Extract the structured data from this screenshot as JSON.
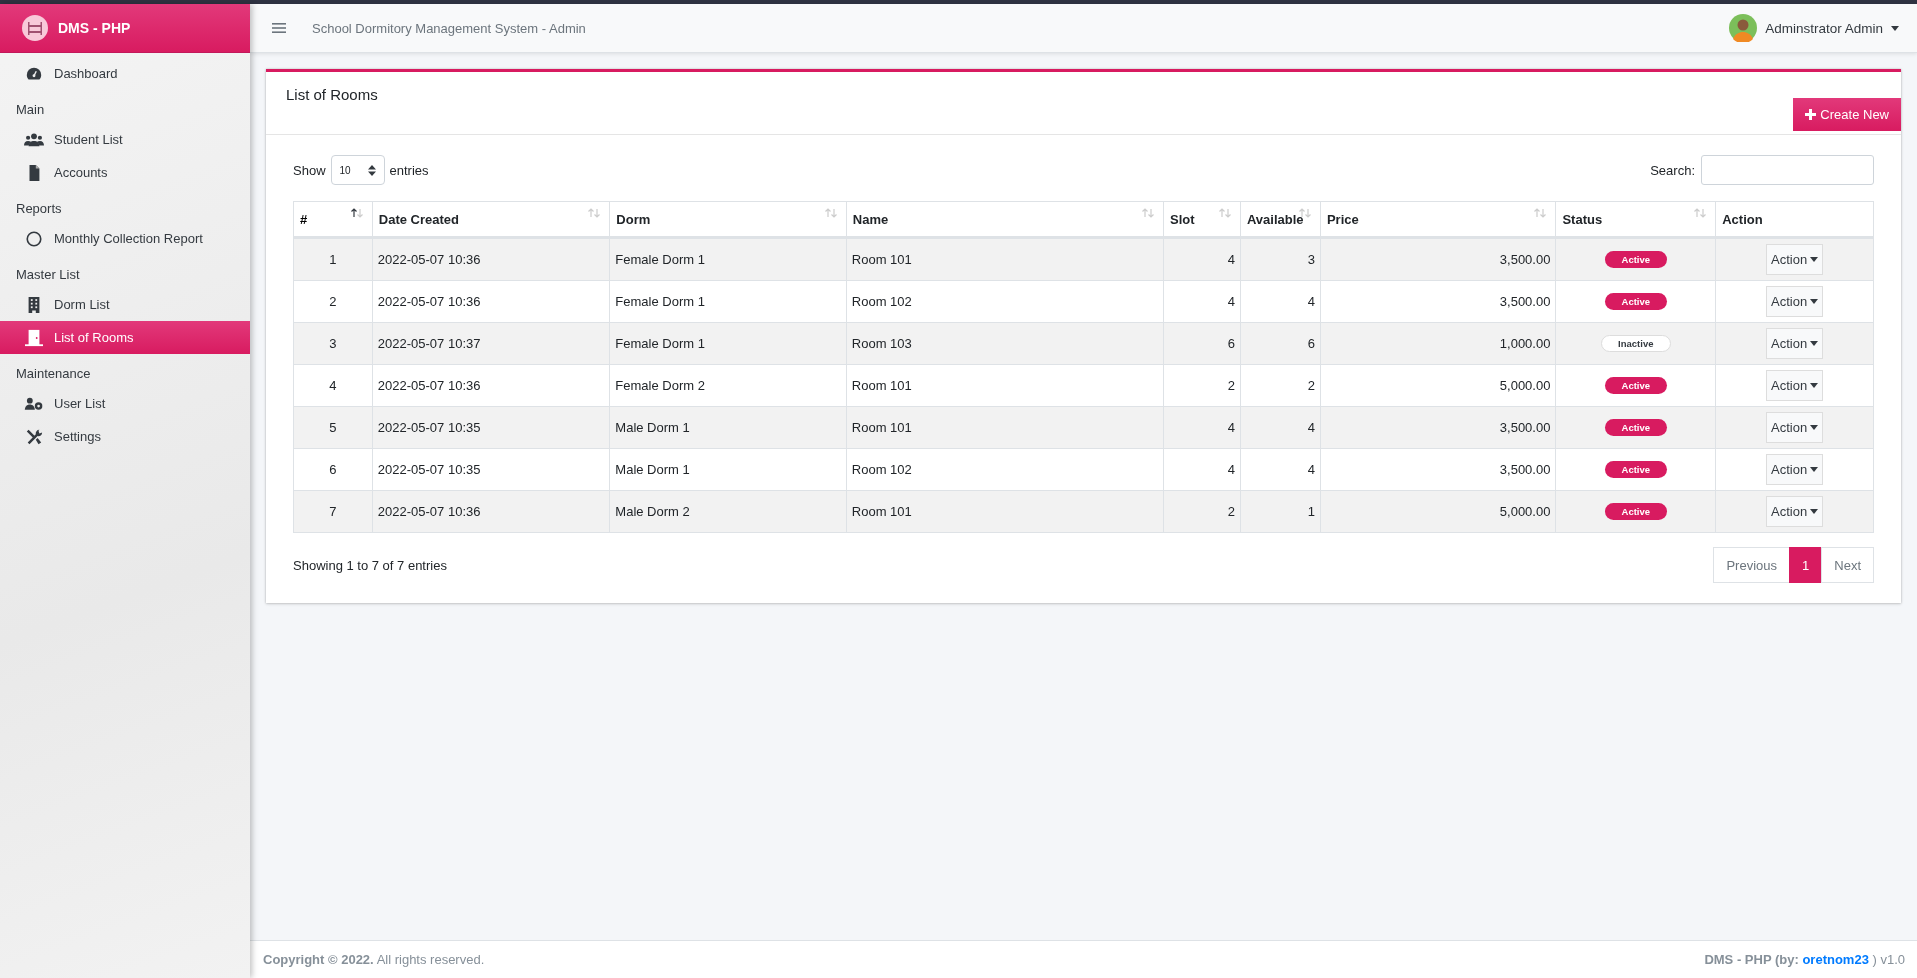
{
  "brand": {
    "title": "DMS - PHP"
  },
  "sidebar": {
    "items": [
      {
        "kind": "item",
        "label": "Dashboard",
        "selected": false
      },
      {
        "kind": "header",
        "label": "Main"
      },
      {
        "kind": "item",
        "label": "Student List",
        "selected": false
      },
      {
        "kind": "item",
        "label": "Accounts",
        "selected": false
      },
      {
        "kind": "header",
        "label": "Reports"
      },
      {
        "kind": "item",
        "label": "Monthly Collection Report",
        "selected": false
      },
      {
        "kind": "header",
        "label": "Master List"
      },
      {
        "kind": "item",
        "label": "Dorm List",
        "selected": false
      },
      {
        "kind": "item",
        "label": "List of Rooms",
        "selected": true
      },
      {
        "kind": "header",
        "label": "Maintenance"
      },
      {
        "kind": "item",
        "label": "User List",
        "selected": false
      },
      {
        "kind": "item",
        "label": "Settings",
        "selected": false
      }
    ]
  },
  "topbar": {
    "title": "School Dormitory Management System - Admin",
    "user": "Adminstrator Admin"
  },
  "card": {
    "title": "List of Rooms",
    "create_button": "Create New",
    "length": {
      "before": "Show",
      "value": "10",
      "after": "entries"
    },
    "search": {
      "label": "Search:"
    },
    "table": {
      "columns": [
        {
          "label": "#",
          "sortable": true,
          "sorted": true
        },
        {
          "label": "Date Created",
          "sortable": true,
          "sorted": false
        },
        {
          "label": "Dorm",
          "sortable": true,
          "sorted": false
        },
        {
          "label": "Name",
          "sortable": true,
          "sorted": false
        },
        {
          "label": "Slot",
          "sortable": true,
          "sorted": false
        },
        {
          "label": "Available",
          "sortable": true,
          "sorted": false
        },
        {
          "label": "Price",
          "sortable": true,
          "sorted": false
        },
        {
          "label": "Status",
          "sortable": true,
          "sorted": false
        },
        {
          "label": "Action",
          "sortable": false,
          "sorted": false
        }
      ],
      "rows": [
        {
          "cells": [
            "1",
            "2022-05-07 10:36",
            "Female Dorm 1",
            "Room 101",
            "4",
            "3",
            "3,500.00"
          ],
          "status": "Active",
          "active": true,
          "action": "Action"
        },
        {
          "cells": [
            "2",
            "2022-05-07 10:36",
            "Female Dorm 1",
            "Room 102",
            "4",
            "4",
            "3,500.00"
          ],
          "status": "Active",
          "active": true,
          "action": "Action"
        },
        {
          "cells": [
            "3",
            "2022-05-07 10:37",
            "Female Dorm 1",
            "Room 103",
            "6",
            "6",
            "1,000.00"
          ],
          "status": "Inactive",
          "active": false,
          "action": "Action"
        },
        {
          "cells": [
            "4",
            "2022-05-07 10:36",
            "Female Dorm 2",
            "Room 101",
            "2",
            "2",
            "5,000.00"
          ],
          "status": "Active",
          "active": true,
          "action": "Action"
        },
        {
          "cells": [
            "5",
            "2022-05-07 10:35",
            "Male Dorm 1",
            "Room 101",
            "4",
            "4",
            "3,500.00"
          ],
          "status": "Active",
          "active": true,
          "action": "Action"
        },
        {
          "cells": [
            "6",
            "2022-05-07 10:35",
            "Male Dorm 1",
            "Room 102",
            "4",
            "4",
            "3,500.00"
          ],
          "status": "Active",
          "active": true,
          "action": "Action"
        },
        {
          "cells": [
            "7",
            "2022-05-07 10:36",
            "Male Dorm 2",
            "Room 101",
            "2",
            "1",
            "5,000.00"
          ],
          "status": "Active",
          "active": true,
          "action": "Action"
        }
      ]
    },
    "info": "Showing 1 to 7 of 7 entries",
    "pagination": [
      {
        "label": "Previous",
        "selected": false
      },
      {
        "label": "1",
        "selected": true
      },
      {
        "label": "Next",
        "selected": false
      }
    ]
  },
  "footer": {
    "copyright": "Copyright © 2022.",
    "rights": "All rights reserved.",
    "app": "DMS - PHP (by: ",
    "author": "oretnom23",
    "version": " ) v1.0"
  }
}
